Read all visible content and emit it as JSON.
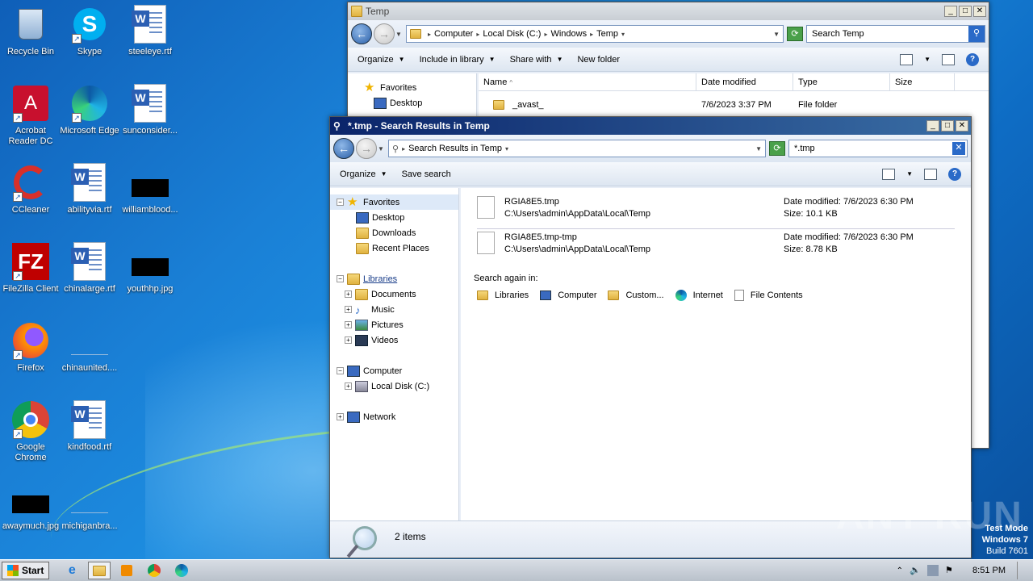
{
  "desktop": {
    "icons": [
      {
        "label": "Recycle Bin"
      },
      {
        "label": "Skype"
      },
      {
        "label": "steeleye.rtf"
      },
      {
        "label": "Acrobat Reader DC"
      },
      {
        "label": "Microsoft Edge"
      },
      {
        "label": "sunconsider..."
      },
      {
        "label": "CCleaner"
      },
      {
        "label": "abilityvia.rtf"
      },
      {
        "label": "williamblood..."
      },
      {
        "label": "FileZilla Client"
      },
      {
        "label": "chinalarge.rtf"
      },
      {
        "label": "youthhp.jpg"
      },
      {
        "label": "Firefox"
      },
      {
        "label": "chinaunited...."
      },
      {
        "label": "Google Chrome"
      },
      {
        "label": "kindfood.rtf"
      },
      {
        "label": "awaymuch.jpg"
      },
      {
        "label": "michiganbra..."
      }
    ]
  },
  "back_window": {
    "title": "Temp",
    "breadcrumb": [
      "Computer",
      "Local Disk (C:)",
      "Windows",
      "Temp"
    ],
    "search_placeholder": "Search Temp",
    "commands": [
      "Organize",
      "Include in library",
      "Share with",
      "New folder"
    ],
    "nav": [
      "Favorites",
      "Desktop"
    ],
    "columns": [
      "Name",
      "Date modified",
      "Type",
      "Size"
    ],
    "rows": [
      {
        "name": "_avast_",
        "date": "7/6/2023 3:37 PM",
        "type": "File folder",
        "size": ""
      }
    ]
  },
  "front_window": {
    "title": "*.tmp - Search Results in Temp",
    "breadcrumb": "Search Results in Temp",
    "search_value": "*.tmp",
    "commands": [
      "Organize",
      "Save search"
    ],
    "nav": {
      "favorites": "Favorites",
      "favorites_items": [
        "Desktop",
        "Downloads",
        "Recent Places"
      ],
      "libraries": "Libraries",
      "library_items": [
        "Documents",
        "Music",
        "Pictures",
        "Videos"
      ],
      "computer": "Computer",
      "computer_items": [
        "Local Disk (C:)"
      ],
      "network": "Network"
    },
    "results": [
      {
        "name": "RGIA8E5.tmp",
        "path": "C:\\Users\\admin\\AppData\\Local\\Temp",
        "date": "Date modified: 7/6/2023 6:30 PM",
        "size": "Size: 10.1 KB"
      },
      {
        "name": "RGIA8E5.tmp-tmp",
        "path": "C:\\Users\\admin\\AppData\\Local\\Temp",
        "date": "Date modified: 7/6/2023 6:30 PM",
        "size": "Size: 8.78 KB"
      }
    ],
    "search_again_label": "Search again in:",
    "search_again": [
      "Libraries",
      "Computer",
      "Custom...",
      "Internet",
      "File Contents"
    ],
    "status": "2 items"
  },
  "taskbar": {
    "start": "Start",
    "clock": "8:51 PM"
  },
  "watermark": {
    "line1": "Test Mode",
    "line2": "Windows 7",
    "line3": "Build 7601",
    "brand": "ANY RUN"
  }
}
